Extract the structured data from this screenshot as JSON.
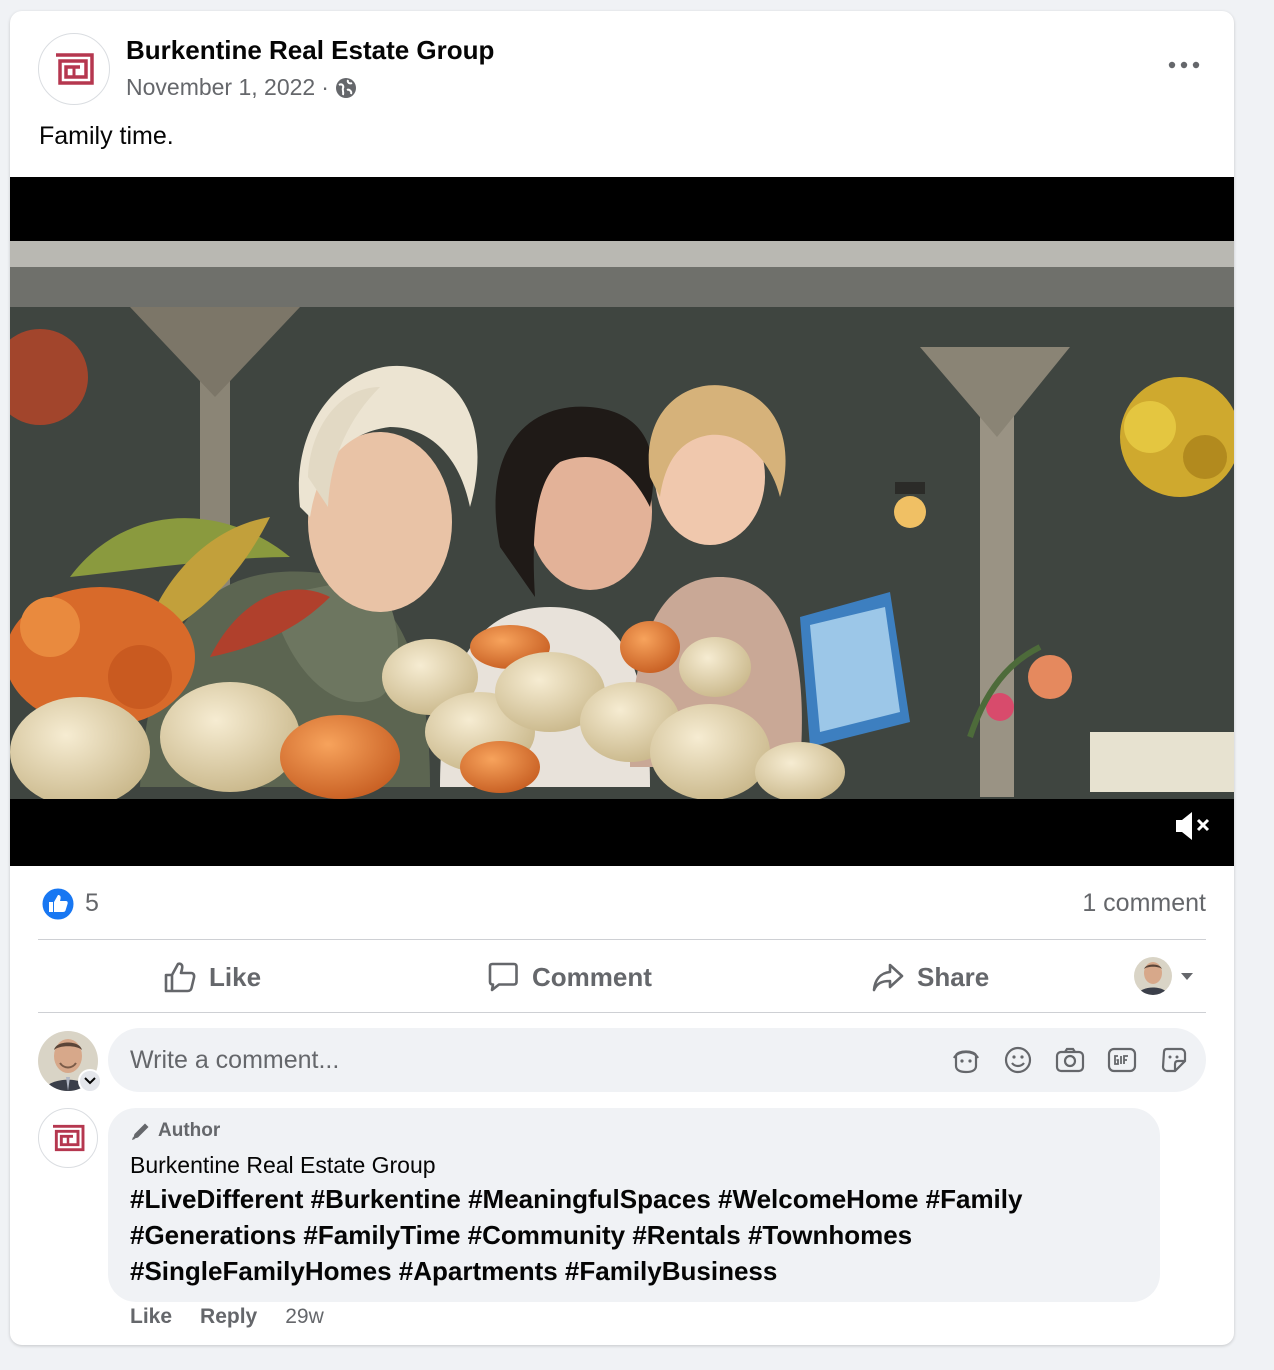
{
  "post": {
    "page_name": "Burkentine Real Estate Group",
    "date": "November 1, 2022",
    "separator": "·",
    "audience_icon": "globe-icon",
    "text": "Family time."
  },
  "video": {
    "muted_icon": "speaker-muted-icon"
  },
  "stats": {
    "reaction_icon": "like-reaction-icon",
    "reaction_count": "5",
    "comment_count": "1 comment"
  },
  "actions": {
    "like": "Like",
    "comment": "Comment",
    "share": "Share"
  },
  "composer": {
    "placeholder": "Write a comment...",
    "tools": [
      "avatar-sticker-icon",
      "emoji-icon",
      "camera-icon",
      "gif-icon",
      "sticker-icon"
    ]
  },
  "comment": {
    "badge": "Author",
    "author": "Burkentine Real Estate Group",
    "text": "#LiveDifferent #Burkentine #MeaningfulSpaces #WelcomeHome #Family #Generations #FamilyTime #Community #Rentals #Townhomes #SingleFamilyHomes #Apartments #FamilyBusiness",
    "like": "Like",
    "reply": "Reply",
    "time": "29w"
  },
  "colors": {
    "brand": "#b5374f",
    "facebook_blue": "#1877f2",
    "secondary_text": "#65676b",
    "bubble_bg": "#f0f2f5"
  }
}
